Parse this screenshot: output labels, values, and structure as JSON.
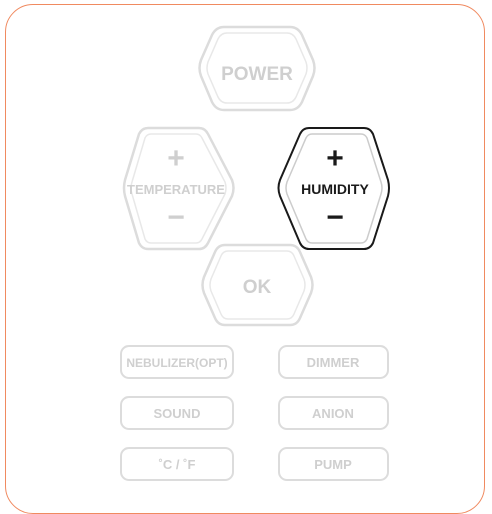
{
  "buttons": {
    "power": "POWER",
    "temperature": "TEMPERATURE",
    "humidity": "HUMIDITY",
    "ok": "OK",
    "plus": "+",
    "minus": "−"
  },
  "functions": {
    "nebulizer": "NEBULIZER(OPT)",
    "dimmer": "DIMMER",
    "sound": "SOUND",
    "anion": "ANION",
    "unit": "˚C / ˚F",
    "pump": "PUMP"
  },
  "colors": {
    "frame": "#f08a60",
    "inactive": "#d9d9d9",
    "inactive_text": "#cfcfcf",
    "active": "#1a1a1a"
  },
  "state": {
    "active_button": "humidity"
  }
}
